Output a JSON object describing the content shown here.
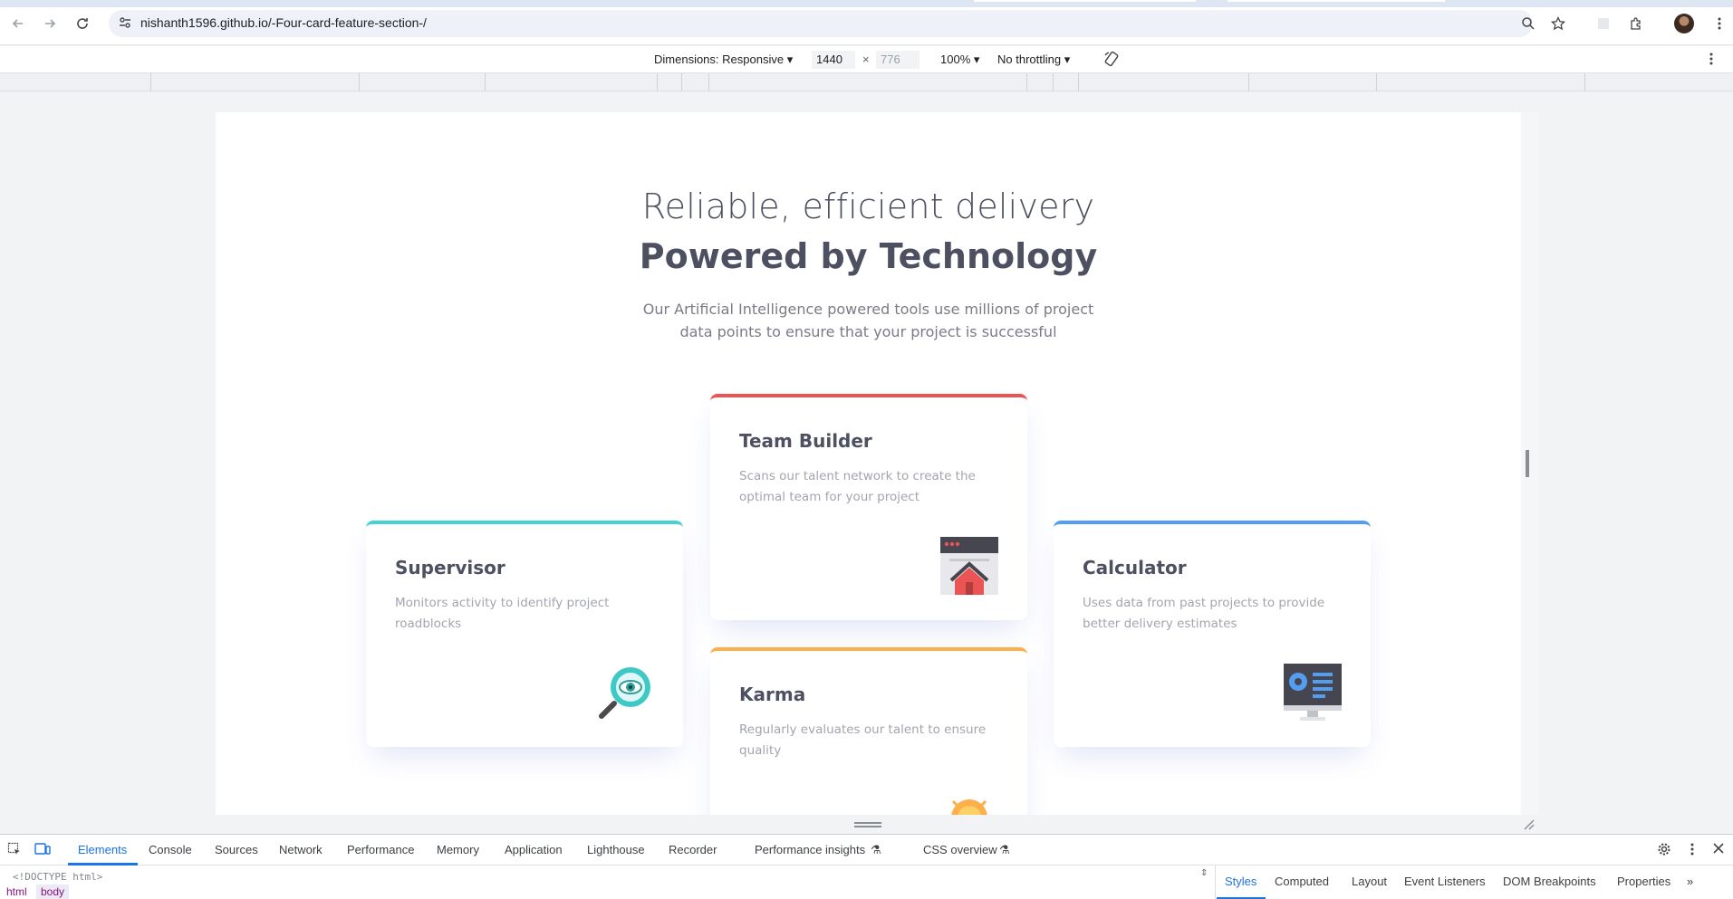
{
  "browser": {
    "url": "nishanth1596.github.io/-Four-card-feature-section-/",
    "back_icon": "arrow-left-icon",
    "forward_icon": "arrow-right-icon",
    "reload_icon": "reload-icon"
  },
  "device_toolbar": {
    "dimensions_label": "Dimensions: Responsive",
    "width_value": "1440",
    "times": "×",
    "height_placeholder": "776",
    "zoom_label": "100%",
    "throttle_label": "No throttling"
  },
  "page": {
    "heading_light": "Reliable, efficient delivery",
    "heading_bold": "Powered by Technology",
    "intro": "Our Artificial Intelligence powered tools use millions of project data points to ensure that your project is successful",
    "cards": [
      {
        "title": "Supervisor",
        "description": "Monitors activity to identify project roadblocks",
        "accent": "#44d3d2",
        "icon": "supervisor-magnifier-icon"
      },
      {
        "title": "Team Builder",
        "description": "Scans our talent network to create the optimal team for your project",
        "accent": "#ea5454",
        "icon": "team-builder-window-icon"
      },
      {
        "title": "Karma",
        "description": "Regularly evaluates our talent to ensure quality",
        "accent": "#fcaf4a",
        "icon": "karma-lightbulb-icon"
      },
      {
        "title": "Calculator",
        "description": "Uses data from past projects to provide better delivery estimates",
        "accent": "#549ef2",
        "icon": "calculator-monitor-icon"
      }
    ]
  },
  "devtools": {
    "tabs": [
      "Elements",
      "Console",
      "Sources",
      "Network",
      "Performance",
      "Memory",
      "Application",
      "Lighthouse",
      "Recorder",
      "Performance insights",
      "CSS overview"
    ],
    "active_tab": "Elements",
    "doctype": "<!DOCTYPE html>",
    "breadcrumbs": [
      "html",
      "body"
    ],
    "side_tabs": [
      "Styles",
      "Computed",
      "Layout",
      "Event Listeners",
      "DOM Breakpoints",
      "Properties"
    ],
    "active_side_tab": "Styles"
  }
}
